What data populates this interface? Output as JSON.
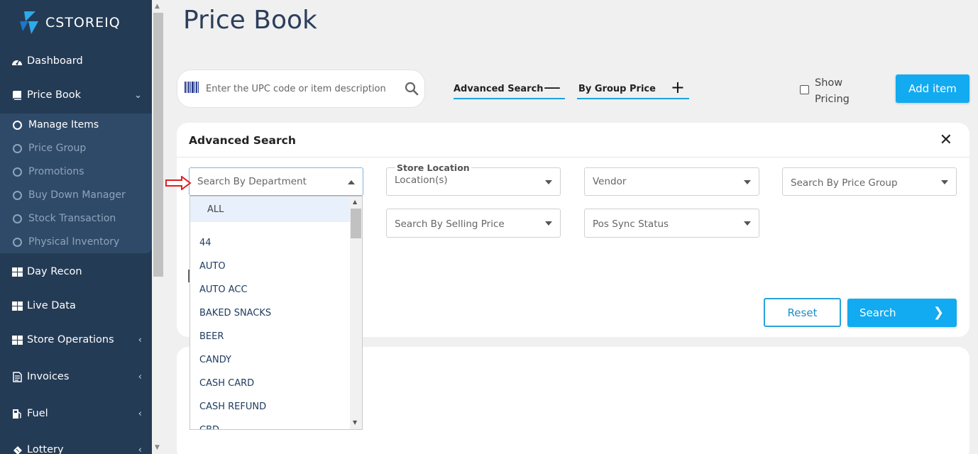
{
  "brand": {
    "name": "CSTOREIQ"
  },
  "sidebar": {
    "items": [
      {
        "label": "Dashboard",
        "icon": "dashboard-icon"
      },
      {
        "label": "Price Book",
        "icon": "book-icon"
      },
      {
        "label": "Day Recon",
        "icon": "grid-icon"
      },
      {
        "label": "Live Data",
        "icon": "grid-icon"
      },
      {
        "label": "Store Operations",
        "icon": "grid-icon"
      },
      {
        "label": "Invoices",
        "icon": "invoice-icon"
      },
      {
        "label": "Fuel",
        "icon": "fuel-icon"
      },
      {
        "label": "Lottery",
        "icon": "ticket-icon"
      }
    ],
    "submenu": [
      {
        "label": "Manage Items",
        "active": true
      },
      {
        "label": "Price Group",
        "active": false
      },
      {
        "label": "Promotions",
        "active": false
      },
      {
        "label": "Buy Down Manager",
        "active": false
      },
      {
        "label": "Stock Transaction",
        "active": false
      },
      {
        "label": "Physical Inventory",
        "active": false
      }
    ]
  },
  "header": {
    "title": "Price Book"
  },
  "search": {
    "placeholder": "Enter the UPC code or item description"
  },
  "tabs": {
    "advanced": "Advanced Search",
    "group": "By Group Price"
  },
  "show_pricing": {
    "line1": "Show",
    "line2": "Pricing"
  },
  "add_item": "Add item",
  "advanced_panel": {
    "title": "Advanced Search",
    "department_placeholder": "Search By Department",
    "store_location_label": "Store Location",
    "store_location_value": "Location(s)",
    "vendor": "Vendor",
    "price_group_placeholder": "Search By Price Group",
    "selling_price_placeholder": "Search By Selling Price",
    "pos_sync_placeholder": "Pos Sync Status",
    "reset": "Reset",
    "search": "Search"
  },
  "department_options": [
    "ALL",
    "44",
    "AUTO",
    "AUTO ACC",
    "BAKED SNACKS",
    "BEER",
    "CANDY",
    "CASH CARD",
    "CASH REFUND",
    "CBD"
  ],
  "colors": {
    "sidebar": "#243b55",
    "accent": "#12aaf0",
    "title": "#2c3e5c"
  }
}
